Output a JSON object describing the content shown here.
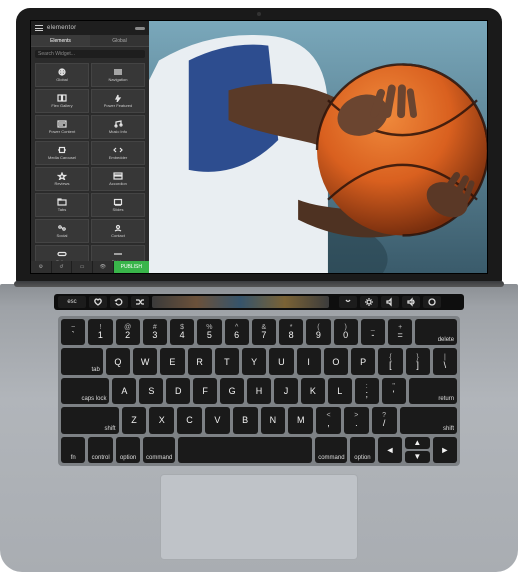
{
  "editor": {
    "brand": "elementor",
    "tabs": {
      "elements": "Elements",
      "global": "Global"
    },
    "search_placeholder": "Search Widget...",
    "widgets": [
      {
        "label": "Global",
        "icon": "globe"
      },
      {
        "label": "Navigation",
        "icon": "nav"
      },
      {
        "label": "Flex Gallery",
        "icon": "gallery"
      },
      {
        "label": "Power Featured",
        "icon": "power"
      },
      {
        "label": "Power Content",
        "icon": "content"
      },
      {
        "label": "Music Info",
        "icon": "music"
      },
      {
        "label": "Media Carousel",
        "icon": "carousel"
      },
      {
        "label": "Embedder",
        "icon": "embed"
      },
      {
        "label": "Reviews",
        "icon": "star"
      },
      {
        "label": "Accordion",
        "icon": "accordion"
      },
      {
        "label": "Tabs",
        "icon": "tabs"
      },
      {
        "label": "Slides",
        "icon": "slides"
      },
      {
        "label": "Social",
        "icon": "social"
      },
      {
        "label": "Contact",
        "icon": "contact"
      },
      {
        "label": "Button",
        "icon": "button"
      },
      {
        "label": "Divider",
        "icon": "divider"
      }
    ],
    "bottom": {
      "settings": "⚙",
      "history": "↺",
      "responsive": "▭",
      "preview": "👁",
      "publish": "PUBLISH"
    }
  },
  "touchbar": {
    "esc": "esc"
  },
  "keyboard": {
    "row1": [
      {
        "sym": "~",
        "main": "`"
      },
      {
        "sym": "!",
        "main": "1"
      },
      {
        "sym": "@",
        "main": "2"
      },
      {
        "sym": "#",
        "main": "3"
      },
      {
        "sym": "$",
        "main": "4"
      },
      {
        "sym": "%",
        "main": "5"
      },
      {
        "sym": "^",
        "main": "6"
      },
      {
        "sym": "&",
        "main": "7"
      },
      {
        "sym": "*",
        "main": "8"
      },
      {
        "sym": "(",
        "main": "9"
      },
      {
        "sym": ")",
        "main": "0"
      },
      {
        "sym": "_",
        "main": "-"
      },
      {
        "sym": "+",
        "main": "="
      }
    ],
    "delete": "delete",
    "tab": "tab",
    "row2": [
      "Q",
      "W",
      "E",
      "R",
      "T",
      "Y",
      "U",
      "I",
      "O",
      "P"
    ],
    "row2end": [
      {
        "sym": "{",
        "main": "["
      },
      {
        "sym": "}",
        "main": "]"
      },
      {
        "sym": "|",
        "main": "\\"
      }
    ],
    "caps": "caps lock",
    "row3": [
      "A",
      "S",
      "D",
      "F",
      "G",
      "H",
      "J",
      "K",
      "L"
    ],
    "row3end": [
      {
        "sym": ":",
        "main": ";"
      },
      {
        "sym": "\"",
        "main": "'"
      }
    ],
    "return": "return",
    "shift": "shift",
    "row4": [
      "Z",
      "X",
      "C",
      "V",
      "B",
      "N",
      "M"
    ],
    "row4end": [
      {
        "sym": "<",
        "main": ","
      },
      {
        "sym": ">",
        "main": "."
      },
      {
        "sym": "?",
        "main": "/"
      }
    ],
    "fn": "fn",
    "control": "control",
    "option": "option",
    "command": "command"
  }
}
